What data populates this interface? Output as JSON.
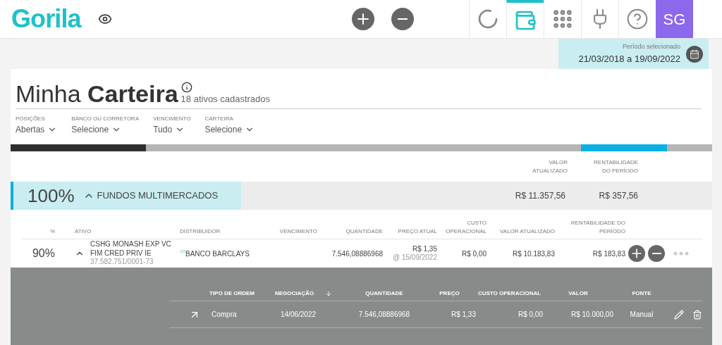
{
  "topbar": {
    "logo": "Gorila",
    "nav": [
      {
        "kind": "loader",
        "selected": false
      },
      {
        "kind": "wallet",
        "selected": true
      },
      {
        "kind": "grid",
        "selected": false
      },
      {
        "kind": "plug",
        "selected": false
      },
      {
        "kind": "help",
        "selected": false
      }
    ],
    "avatar": "SG"
  },
  "period": {
    "label": "Período selecionado",
    "value": "21/03/2018 a 19/09/2022"
  },
  "title": {
    "light": "Minha",
    "bold": "Carteira",
    "subtitle": "18 ativos cadastrados"
  },
  "filters": [
    {
      "label": "POSIÇÕES",
      "value": "Abertas"
    },
    {
      "label": "BANCO OU CORRETORA",
      "value": "Selecione"
    },
    {
      "label": "VENCIMENTO",
      "value": "Tudo"
    },
    {
      "label": "CARTEIRA",
      "value": "Selecione"
    }
  ],
  "summary_headers": [
    "VALOR ATUALIZADO",
    "RENTABILIDADE DO PERÍODO"
  ],
  "group": {
    "percent": "100%",
    "name": "FUNDOS MULTIMERCADOS",
    "expanded": true,
    "value": "R$ 11.357,56",
    "return": "R$ 357,56"
  },
  "table": {
    "columns": [
      "%",
      "ATIVO",
      "DISTRIBUIDOR",
      "VENCIMENTO",
      "QUANTIDADE",
      "PREÇO ATUAL",
      "CUSTO OPERACIONAL",
      "VALOR ATUALIZADO",
      "RENTABILIDADE DO PERÍODO"
    ],
    "rows": [
      {
        "percent": "90%",
        "expanded": true,
        "asset": "CSHG MONASH EXP VC FIM CRED PRIV IE",
        "cnpj": "37.582.751/0001-73",
        "distributor": "BANCO BARCLAYS",
        "maturity": "",
        "quantity": "7.546,08886968",
        "price": "R$ 1,35",
        "price_date": "@ 15/09/2022",
        "cost": "R$ 0,00",
        "value": "R$ 10.183,83",
        "return": "R$ 183,83"
      }
    ]
  },
  "orders": {
    "columns": [
      "TIPO DE ORDEM",
      "NEGOCIAÇÃO",
      "QUANTIDADE",
      "PREÇO",
      "CUSTO OPERACIONAL",
      "VALOR",
      "FONTE"
    ],
    "rows": [
      {
        "type": "Compra",
        "date": "14/06/2022",
        "quantity": "7.546,08886968",
        "price": "R$ 1,33",
        "cost": "R$ 0,00",
        "value": "R$ 10.000,00",
        "source": "Manual"
      }
    ]
  }
}
